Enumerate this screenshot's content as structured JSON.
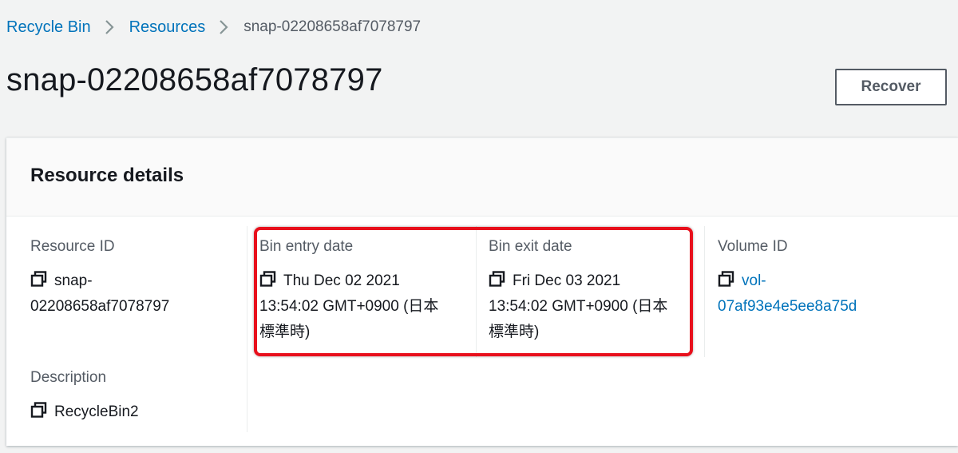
{
  "breadcrumb": {
    "items": [
      "Recycle Bin",
      "Resources"
    ],
    "current": "snap-02208658af7078797"
  },
  "page": {
    "title": "snap-02208658af7078797",
    "recover_label": "Recover"
  },
  "panel": {
    "title": "Resource details",
    "resource_id": {
      "label": "Resource ID",
      "line1": "snap-",
      "line2": "02208658af7078797"
    },
    "description": {
      "label": "Description",
      "value": "RecycleBin2"
    },
    "bin_entry": {
      "label": "Bin entry date",
      "line1": "Thu Dec 02 2021",
      "line2": "13:54:02 GMT+0900 (日本",
      "line3": "標準時)"
    },
    "bin_exit": {
      "label": "Bin exit date",
      "line1": "Fri Dec 03 2021",
      "line2": "13:54:02 GMT+0900 (日本",
      "line3": "標準時)"
    },
    "volume_id": {
      "label": "Volume ID",
      "line1": "vol-",
      "line2": "07af93e4e5ee8a75d"
    }
  },
  "colors": {
    "link": "#0073bb",
    "highlight": "#e8101c",
    "background": "#f2f3f3"
  },
  "icons": {
    "copy": "copy-icon",
    "breadcrumb_separator": "chevron-right-icon"
  }
}
